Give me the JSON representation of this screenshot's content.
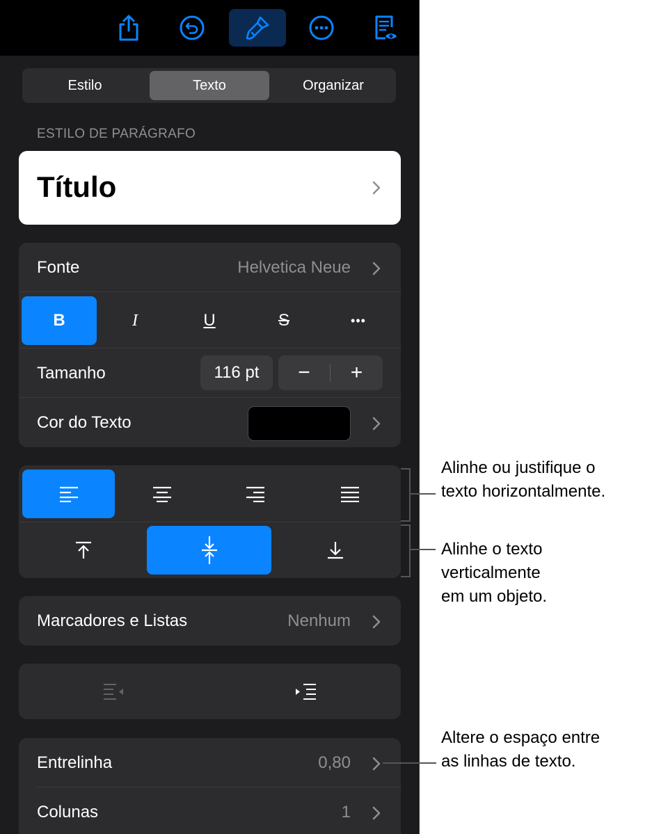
{
  "toolbar": {
    "icons": [
      "share-icon",
      "undo-icon",
      "format-brush-icon",
      "more-icon",
      "reader-view-icon"
    ],
    "accent": "#0a84ff"
  },
  "tabs": [
    {
      "label": "Estilo",
      "selected": false
    },
    {
      "label": "Texto",
      "selected": true
    },
    {
      "label": "Organizar",
      "selected": false
    }
  ],
  "paragraph_style": {
    "section_label": "ESTILO DE PARÁGRAFO",
    "value": "Título"
  },
  "font": {
    "label": "Fonte",
    "value": "Helvetica Neue",
    "styles": [
      {
        "label": "B",
        "name": "bold",
        "active": true
      },
      {
        "label": "I",
        "name": "italic",
        "active": false
      },
      {
        "label": "U",
        "name": "underline",
        "active": false
      },
      {
        "label": "S",
        "name": "strikethrough",
        "active": false
      },
      {
        "label": "•••",
        "name": "more-styles",
        "active": false
      }
    ],
    "size_label": "Tamanho",
    "size_value": "116 pt",
    "decrease": "−",
    "increase": "+",
    "color_label": "Cor do Texto",
    "color_value": "#000000"
  },
  "alignment": {
    "horizontal": [
      "align-left",
      "align-center",
      "align-right",
      "justify"
    ],
    "horizontal_selected": "align-left",
    "vertical": [
      "align-top",
      "align-middle",
      "align-bottom"
    ],
    "vertical_selected": "align-middle"
  },
  "bullets": {
    "label": "Marcadores e Listas",
    "value": "Nenhum"
  },
  "indent": {
    "decrease_enabled": false,
    "increase_enabled": true
  },
  "spacing": {
    "line_label": "Entrelinha",
    "line_value": "0,80",
    "columns_label": "Colunas",
    "columns_value": "1"
  },
  "callouts": {
    "horizontal_line1": "Alinhe ou justifique o",
    "horizontal_line2": "texto horizontalmente.",
    "vertical_line1": "Alinhe o texto",
    "vertical_line2": "verticalmente",
    "vertical_line3": "em um objeto.",
    "spacing_line1": "Altere o espaço entre",
    "spacing_line2": "as linhas de texto."
  }
}
